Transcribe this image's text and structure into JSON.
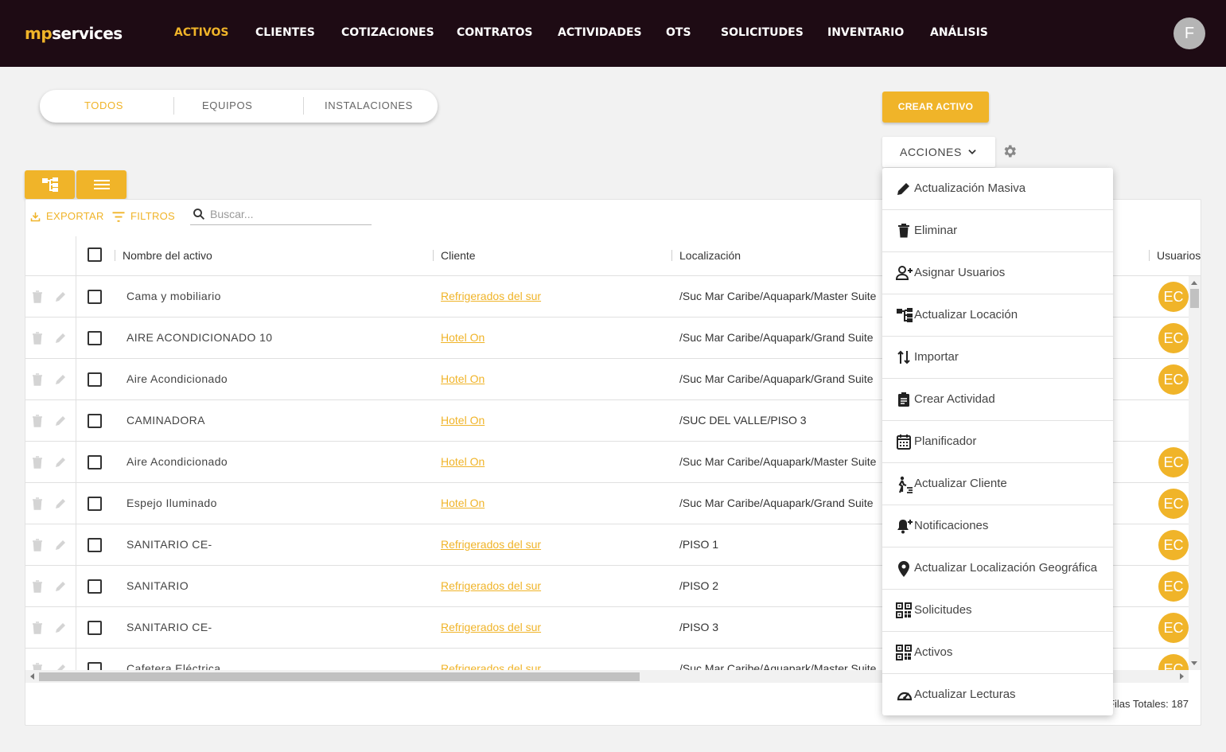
{
  "app": {
    "logo_prefix": "mp",
    "logo_suffix": "services",
    "user_initial": "F"
  },
  "nav": {
    "items": [
      "ACTIVOS",
      "CLIENTES",
      "COTIZACIONES",
      "CONTRATOS",
      "ACTIVIDADES",
      "OTS",
      "SOLICITUDES",
      "INVENTARIO",
      "ANÁLISIS"
    ],
    "active": "ACTIVOS"
  },
  "tabs": {
    "items": [
      "TODOS",
      "EQUIPOS",
      "INSTALACIONES"
    ],
    "active": "TODOS"
  },
  "toolbar": {
    "create_label": "CREAR ACTIVO",
    "actions_label": "ACCIONES",
    "export_label": "EXPORTAR",
    "filters_label": "FILTROS",
    "search_placeholder": "Buscar..."
  },
  "table": {
    "columns": [
      "Nombre del activo",
      "Cliente",
      "Localización",
      "Usuarios"
    ],
    "rows": [
      {
        "name": "Cama y mobiliario",
        "client": "Refrigerados del sur",
        "location": "/Suc Mar Caribe/Aquapark/Master Suite",
        "user": "EC"
      },
      {
        "name": "AIRE ACONDICIONADO 10",
        "client": "Hotel On",
        "location": "/Suc Mar Caribe/Aquapark/Grand Suite",
        "user": "EC"
      },
      {
        "name": "Aire Acondicionado",
        "client": "Hotel On",
        "location": "/Suc Mar Caribe/Aquapark/Grand Suite",
        "user": "EC"
      },
      {
        "name": "CAMINADORA",
        "client": "Hotel On",
        "location": "/SUC DEL VALLE/PISO 3",
        "user": ""
      },
      {
        "name": "Aire Acondicionado",
        "client": "Hotel On",
        "location": "/Suc Mar Caribe/Aquapark/Master Suite",
        "user": "EC"
      },
      {
        "name": "Espejo Iluminado",
        "client": "Hotel On",
        "location": "/Suc Mar Caribe/Aquapark/Grand Suite",
        "user": "EC"
      },
      {
        "name": "SANITARIO CE-",
        "client": "Refrigerados del sur",
        "location": "/PISO 1",
        "user": "EC"
      },
      {
        "name": "SANITARIO",
        "client": "Refrigerados del sur",
        "location": "/PISO 2",
        "user": "EC"
      },
      {
        "name": "SANITARIO CE-",
        "client": "Refrigerados del sur",
        "location": "/PISO 3",
        "user": "EC"
      },
      {
        "name": "Cafetera Eléctrica",
        "client": "Refrigerados del sur",
        "location": "/Suc Mar Caribe/Aquapark/Master Suite",
        "user": "EC"
      }
    ],
    "footer_count": "Filas Totales: 187"
  },
  "menu": {
    "items": [
      {
        "label": "Actualización Masiva",
        "icon": "pencil-icon"
      },
      {
        "label": "Eliminar",
        "icon": "trash-icon"
      },
      {
        "label": "Asignar Usuarios",
        "icon": "person-add-icon"
      },
      {
        "label": "Actualizar Locación",
        "icon": "hierarchy-icon"
      },
      {
        "label": "Importar",
        "icon": "import-arrows-icon"
      },
      {
        "label": "Crear Actividad",
        "icon": "clipboard-icon"
      },
      {
        "label": "Planificador",
        "icon": "calendar-icon"
      },
      {
        "label": "Actualizar Cliente",
        "icon": "person-walking-icon"
      },
      {
        "label": "Notificaciones",
        "icon": "bell-add-icon"
      },
      {
        "label": "Actualizar Localización Geográfica",
        "icon": "map-pin-icon"
      },
      {
        "label": "Solicitudes",
        "icon": "qr-code-icon"
      },
      {
        "label": "Activos",
        "icon": "qr-code-icon"
      },
      {
        "label": "Actualizar Lecturas",
        "icon": "gauge-icon"
      }
    ]
  },
  "colors": {
    "accent": "#f0b429",
    "topbar": "#1e0b14"
  }
}
